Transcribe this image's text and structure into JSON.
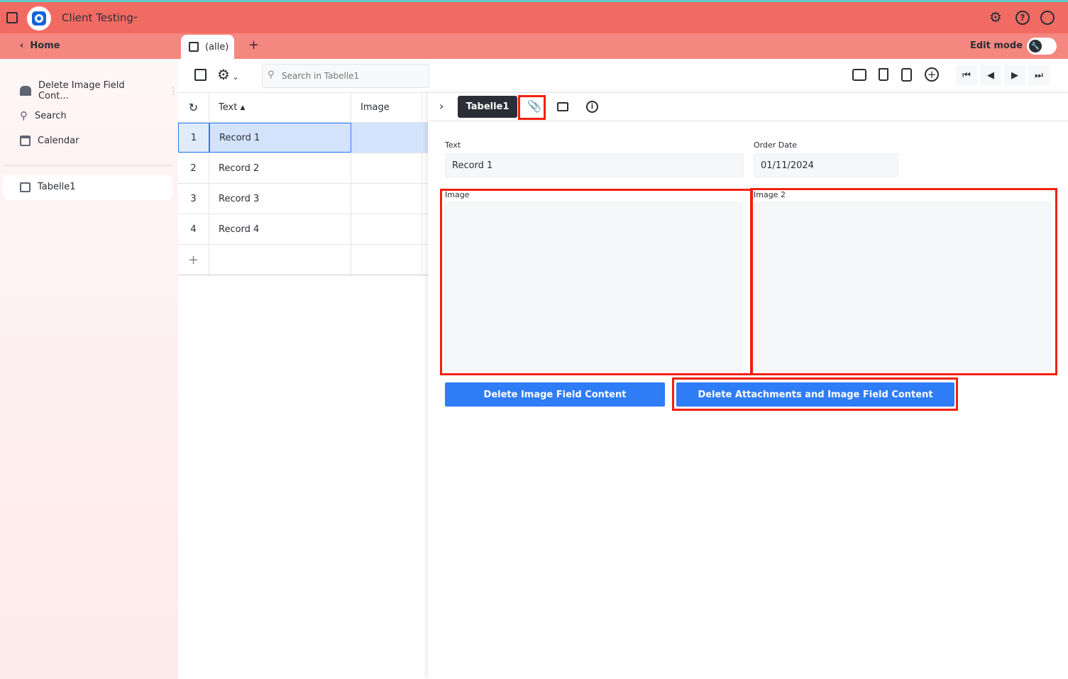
{
  "app": {
    "title": "Client Testing"
  },
  "subbar": {
    "home": "Home",
    "tab": "(alle)",
    "add": "+",
    "edit_mode": "Edit mode"
  },
  "sidebar": {
    "items": [
      {
        "label": "Delete Image Field Cont...",
        "icon": "home-icon"
      },
      {
        "label": "Search",
        "icon": "search-icon"
      },
      {
        "label": "Calendar",
        "icon": "calendar-icon"
      },
      {
        "label": "Tabelle1",
        "icon": "table-icon"
      }
    ]
  },
  "toolbar": {
    "search_placeholder": "Search in Tabelle1"
  },
  "table": {
    "columns": [
      "Text",
      "Image"
    ],
    "rows": [
      {
        "n": "1",
        "text": "Record 1"
      },
      {
        "n": "2",
        "text": "Record 2"
      },
      {
        "n": "3",
        "text": "Record 3"
      },
      {
        "n": "4",
        "text": "Record 4"
      }
    ]
  },
  "detail": {
    "tab": "Tabelle1",
    "fields": {
      "text_label": "Text",
      "text_value": "Record 1",
      "date_label": "Order Date",
      "date_value": "01/11/2024",
      "image_label": "Image",
      "image2_label": "Image 2"
    },
    "buttons": {
      "delete_image": "Delete Image Field Content",
      "delete_all": "Delete Attachments and Image Field Content"
    }
  },
  "colors": {
    "header": "#f26b63",
    "subheader": "#f4877f",
    "accent": "#2e7cf6",
    "highlight": "#f2200d"
  }
}
